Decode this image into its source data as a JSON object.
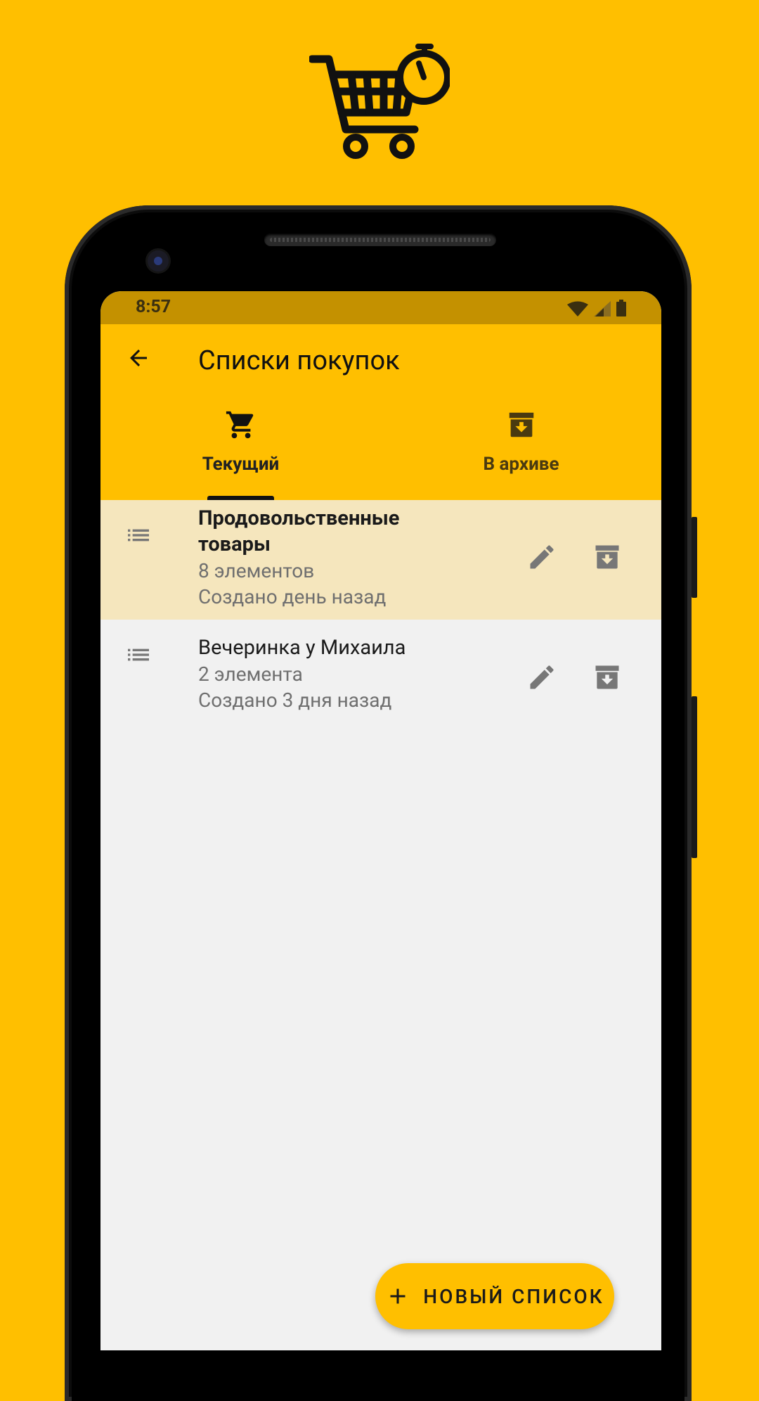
{
  "colors": {
    "background": "#FFBF00",
    "status_bar": "#C49100",
    "selected_row": "#F5E6BD",
    "screen_bg": "#F1F1F1"
  },
  "icons": {
    "logo": "shopping-cart-timer-icon",
    "back": "arrow-back-icon",
    "tab_current": "shopping-cart-icon",
    "tab_archive": "archive-icon",
    "drag": "list-icon",
    "edit": "pencil-icon",
    "archive": "archive-icon",
    "fab": "plus-icon"
  },
  "status_bar": {
    "time": "8:57"
  },
  "app_bar": {
    "title": "Списки покупок"
  },
  "tabs": [
    {
      "label": "Текущий",
      "selected": true
    },
    {
      "label": "В архиве",
      "selected": false
    }
  ],
  "lists": [
    {
      "title": "Продовольственные товары",
      "count": "8 элементов",
      "created": "Создано день назад",
      "selected": true
    },
    {
      "title": "Вечеринка у Михаила",
      "count": "2 элемента",
      "created": "Создано 3 дня назад",
      "selected": false
    }
  ],
  "fab": {
    "label": "НОВЫЙ СПИСОК"
  }
}
